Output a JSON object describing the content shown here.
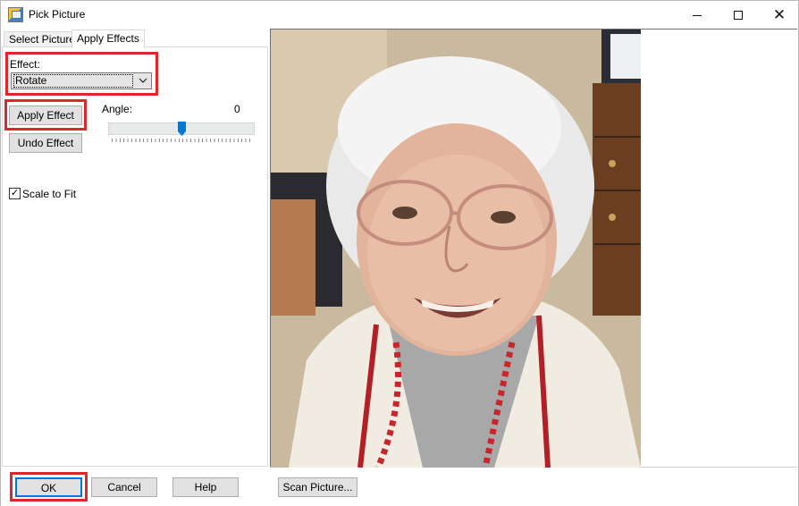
{
  "window": {
    "title": "Pick Picture",
    "minimize_icon": "minimize-icon",
    "maximize_icon": "maximize-icon",
    "close_icon": "close-icon"
  },
  "tabs": [
    {
      "label": "Select Picture",
      "active": false
    },
    {
      "label": "Apply Effects",
      "active": true
    }
  ],
  "effects": {
    "effect_label": "Effect:",
    "effect_value": "Rotate",
    "apply_label": "Apply Effect",
    "undo_label": "Undo Effect",
    "angle_label": "Angle:",
    "angle_value": "0",
    "scale_label": "Scale to Fit",
    "scale_checked": true
  },
  "footer": {
    "ok_label": "OK",
    "cancel_label": "Cancel",
    "help_label": "Help",
    "scan_label": "Scan Picture..."
  },
  "colors": {
    "highlight": "#e0262c",
    "focus": "#0078d7",
    "button_face": "#e1e1e1"
  }
}
